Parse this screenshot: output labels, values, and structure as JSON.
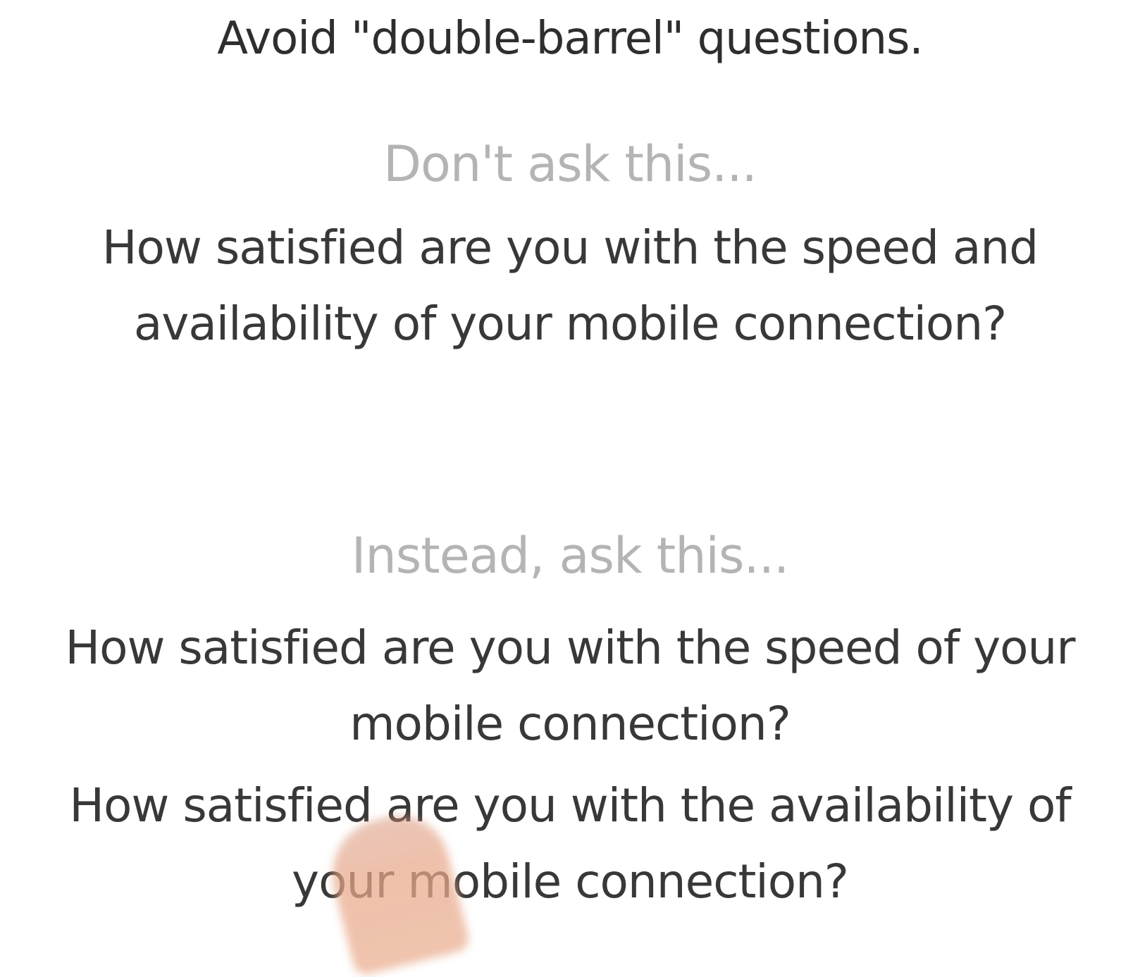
{
  "heading": "Avoid \"double-barrel\" questions.",
  "dont": {
    "label": "Don't ask this...",
    "question_lines": [
      "How satisfied are you with the speed and",
      "availability of your mobile connection?"
    ]
  },
  "instead": {
    "label": "Instead, ask this...",
    "questions": [
      {
        "lines": [
          "How satisfied are you with the speed of your",
          "mobile connection?"
        ]
      },
      {
        "lines": [
          "How satisfied are you with the availability of",
          "your mobile connection?"
        ]
      }
    ]
  },
  "colors": {
    "text": "#383838",
    "label": "#b4b4b4",
    "background": "#ffffff"
  }
}
